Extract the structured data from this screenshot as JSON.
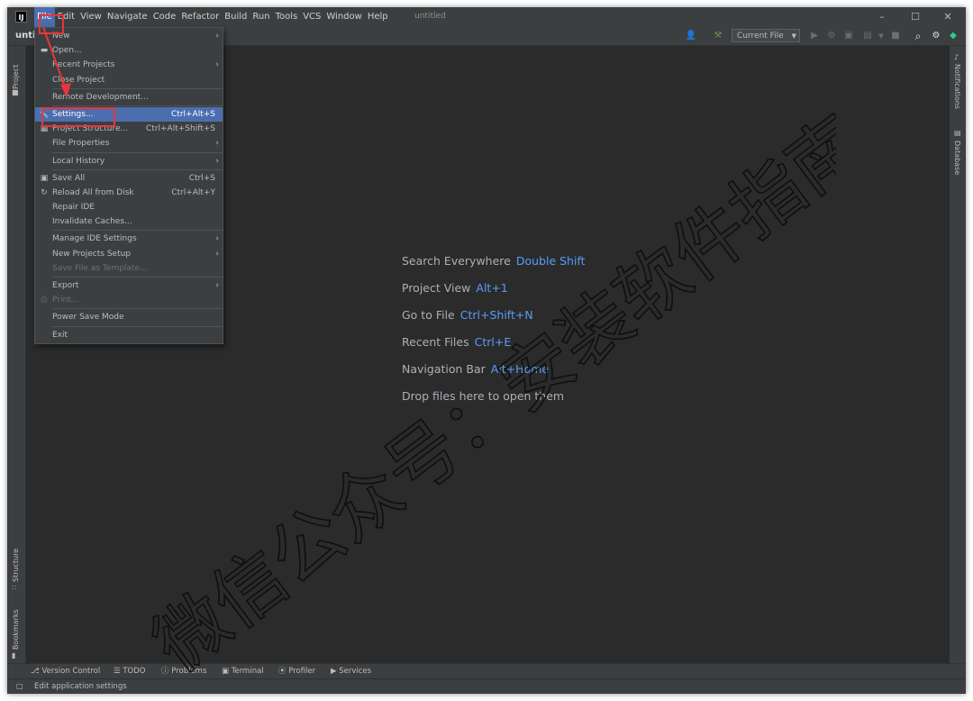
{
  "window": {
    "title": "untitled",
    "project_name": "unti"
  },
  "app_logo": "IJ",
  "menubar": [
    "File",
    "Edit",
    "View",
    "Navigate",
    "Code",
    "Refactor",
    "Build",
    "Run",
    "Tools",
    "VCS",
    "Window",
    "Help"
  ],
  "toolbar": {
    "run_config": "Current File"
  },
  "side_tabs": {
    "left_top": "Project",
    "left_structure": "Structure",
    "left_bookmarks": "Bookmarks",
    "right_notifications": "Notifications",
    "right_database": "Database"
  },
  "file_menu": {
    "new": "New",
    "open": "Open...",
    "recent_projects": "Recent Projects",
    "close_project": "Close Project",
    "remote_development": "Remote Development...",
    "settings": "Settings...",
    "settings_shortcut": "Ctrl+Alt+S",
    "project_structure": "Project Structure...",
    "project_structure_shortcut": "Ctrl+Alt+Shift+S",
    "file_properties": "File Properties",
    "local_history": "Local History",
    "save_all": "Save All",
    "save_all_shortcut": "Ctrl+S",
    "reload_all": "Reload All from Disk",
    "reload_all_shortcut": "Ctrl+Alt+Y",
    "repair_ide": "Repair IDE",
    "invalidate_caches": "Invalidate Caches...",
    "manage_ide_settings": "Manage IDE Settings",
    "new_projects_setup": "New Projects Setup",
    "save_file_as_template": "Save File as Template...",
    "export": "Export",
    "print": "Print...",
    "power_save_mode": "Power Save Mode",
    "exit": "Exit"
  },
  "welcome": {
    "search_everywhere": {
      "label": "Search Everywhere",
      "key": "Double Shift"
    },
    "project_view": {
      "label": "Project View",
      "key": "Alt+1"
    },
    "go_to_file": {
      "label": "Go to File",
      "key": "Ctrl+Shift+N"
    },
    "recent_files": {
      "label": "Recent Files",
      "key": "Ctrl+E"
    },
    "navigation_bar": {
      "label": "Navigation Bar",
      "key": "Alt+Home"
    },
    "drop_files": "Drop files here to open them"
  },
  "bottom_tabs": [
    "Version Control",
    "TODO",
    "Problems",
    "Terminal",
    "Profiler",
    "Services"
  ],
  "status_text": "Edit application settings",
  "watermark": "微信公众号：安装软件指南",
  "colors": {
    "accent": "#4b6eaf",
    "key_text": "#589df6",
    "annotation": "#e8353b",
    "background": "#2b2b2b"
  }
}
